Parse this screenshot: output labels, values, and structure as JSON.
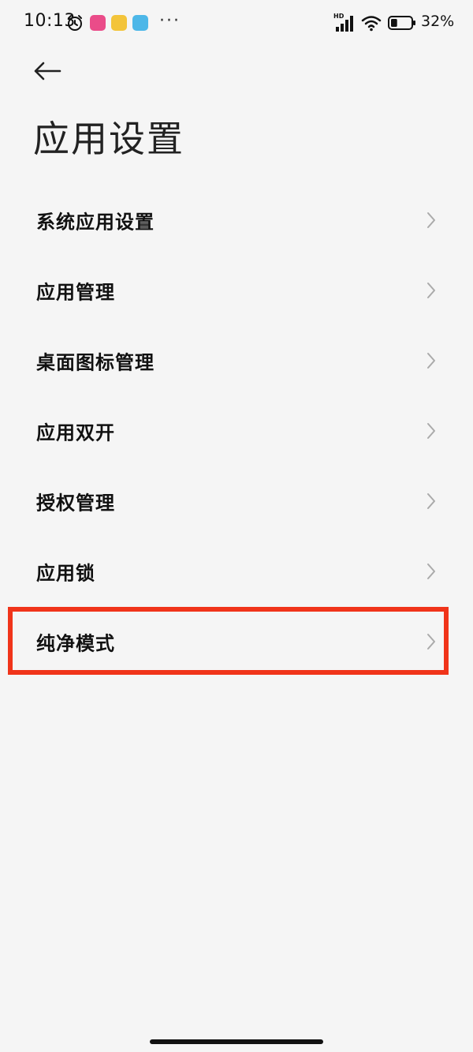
{
  "status_bar": {
    "time": "10:13",
    "more": "···",
    "hd": "HD",
    "battery": "32%",
    "battery_level": 0.32
  },
  "header": {
    "back_icon": "arrow-left-icon",
    "title": "应用设置"
  },
  "items": [
    {
      "label": "系统应用设置"
    },
    {
      "label": "应用管理"
    },
    {
      "label": "桌面图标管理"
    },
    {
      "label": "应用双开"
    },
    {
      "label": "授权管理"
    },
    {
      "label": "应用锁"
    },
    {
      "label": "纯净模式"
    }
  ],
  "colors": {
    "background": "#f5f5f5",
    "highlight": "#f0341a",
    "chevron": "#aaaaaa"
  }
}
